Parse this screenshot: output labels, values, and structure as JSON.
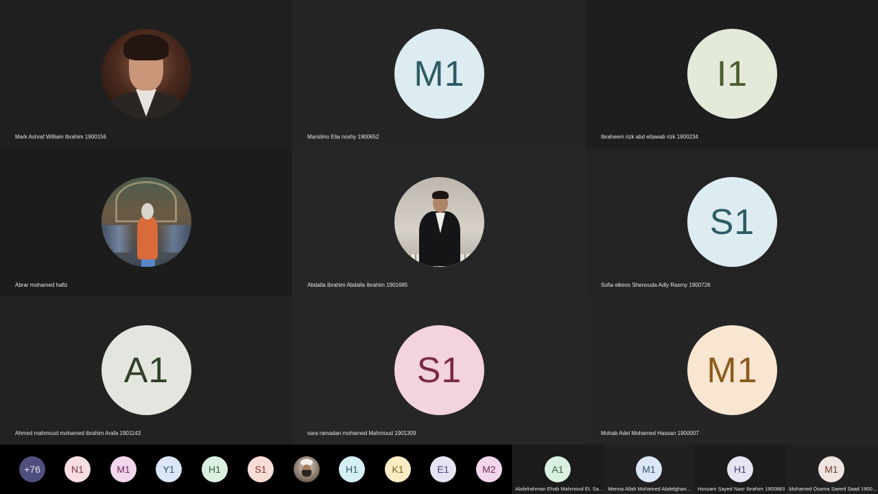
{
  "colors": {
    "background": "#141414",
    "strip_background": "#111111",
    "text": "#e8e8e8"
  },
  "participants": [
    {
      "name": "Mark Ashraf William Ibrahim 1900156",
      "initials": "",
      "avatar": "photo-man-suit"
    },
    {
      "name": "Marsilino Elia noshy 1900652",
      "initials": "M1",
      "bg": "#dcecf1",
      "fg": "#2e5b63"
    },
    {
      "name": "Ibraheem rizk abd eltawab rizk 1900234",
      "initials": "I1",
      "bg": "#e3ead9",
      "fg": "#4b5d2f"
    },
    {
      "name": "Abrar mohamed hafiz",
      "initials": "",
      "avatar": "photo-woman-orange"
    },
    {
      "name": "Abdalla Ibrahim Abdalla Ibrahim 1901685",
      "initials": "",
      "avatar": "photo-man-tuxedo"
    },
    {
      "name": "Sofia elkess Shenouda Adly Rasmy 1900726",
      "initials": "S1",
      "bg": "#dcecf1",
      "fg": "#2e5b63"
    },
    {
      "name": "Ahmed mahmoud mohamed ibrahim Arafa 1901143",
      "initials": "A1",
      "bg": "#e3e6df",
      "fg": "#2f3f28"
    },
    {
      "name": "sara ramadan mohamed Mahmoud 1901309",
      "initials": "S1",
      "bg": "#f3d3df",
      "fg": "#7a2a44"
    },
    {
      "name": "Mohab Adel Mohamed Hassan 1900007",
      "initials": "M1",
      "bg": "#f9e6d0",
      "fg": "#8a5a20"
    }
  ],
  "strip": {
    "overflow_count": "+76",
    "avatars": [
      {
        "initials": "N1",
        "bg": "#f8dde3",
        "fg": "#7a3040"
      },
      {
        "initials": "M1",
        "bg": "#f2d6ec",
        "fg": "#6d2a5e"
      },
      {
        "initials": "Y1",
        "bg": "#dbe7f6",
        "fg": "#2b4e78"
      },
      {
        "initials": "H1",
        "bg": "#daf0e0",
        "fg": "#2b5e3a"
      },
      {
        "initials": "S1",
        "bg": "#f8dcd6",
        "fg": "#7a3328"
      },
      {
        "initials": "",
        "avatar": "photo-man-turban"
      },
      {
        "initials": "H1",
        "bg": "#d6eff3",
        "fg": "#2a5c66"
      },
      {
        "initials": "K1",
        "bg": "#fbecc4",
        "fg": "#7a5a12"
      },
      {
        "initials": "E1",
        "bg": "#e6e4f3",
        "fg": "#433d70"
      },
      {
        "initials": "M2",
        "bg": "#f2d6ec",
        "fg": "#6d2a5e"
      }
    ],
    "named": [
      {
        "name": "Abdelrahman Ehab Mahmoud EL Sa...",
        "initials": "A1",
        "bg": "#daf0e0",
        "fg": "#2b5e3a"
      },
      {
        "name": "Menna Allah  Mohamed Abdelghan...",
        "initials": "M1",
        "bg": "#dbe7f6",
        "fg": "#2b4e78"
      },
      {
        "name": "Hossam Sayed Nasr Ibrahim 1900883",
        "initials": "H1",
        "bg": "#e6e4f3",
        "fg": "#433d70"
      },
      {
        "name": "Mohamed Osama Saeed Saad 1900...",
        "initials": "M1",
        "bg": "#efe4df",
        "fg": "#6a3a2a"
      }
    ]
  }
}
